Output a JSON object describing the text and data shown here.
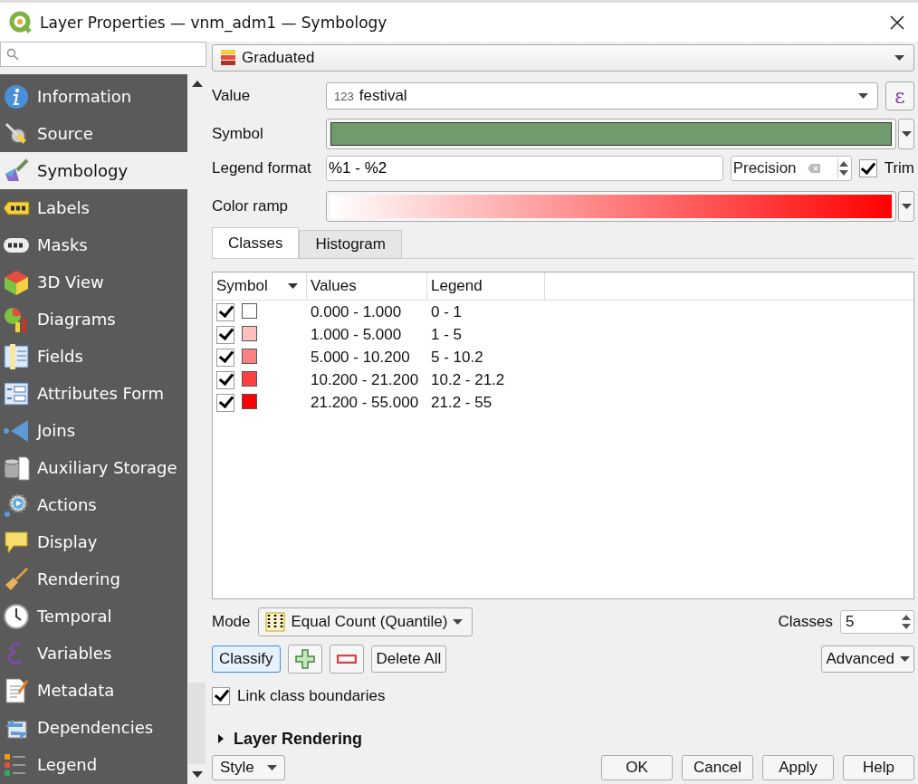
{
  "window": {
    "title": "Layer Properties — vnm_adm1 — Symbology"
  },
  "sidebar": {
    "items": [
      {
        "label": "Information",
        "selected": false
      },
      {
        "label": "Source",
        "selected": false
      },
      {
        "label": "Symbology",
        "selected": true
      },
      {
        "label": "Labels",
        "selected": false
      },
      {
        "label": "Masks",
        "selected": false
      },
      {
        "label": "3D View",
        "selected": false
      },
      {
        "label": "Diagrams",
        "selected": false
      },
      {
        "label": "Fields",
        "selected": false
      },
      {
        "label": "Attributes Form",
        "selected": false
      },
      {
        "label": "Joins",
        "selected": false
      },
      {
        "label": "Auxiliary Storage",
        "selected": false
      },
      {
        "label": "Actions",
        "selected": false
      },
      {
        "label": "Display",
        "selected": false
      },
      {
        "label": "Rendering",
        "selected": false
      },
      {
        "label": "Temporal",
        "selected": false
      },
      {
        "label": "Variables",
        "selected": false
      },
      {
        "label": "Metadata",
        "selected": false
      },
      {
        "label": "Dependencies",
        "selected": false
      },
      {
        "label": "Legend",
        "selected": false
      }
    ]
  },
  "renderer": "Graduated",
  "value": {
    "label": "Value",
    "type_badge": "123",
    "field": "festival",
    "expression_glyph": "ε"
  },
  "symbol": {
    "label": "Symbol"
  },
  "legend_format": {
    "label": "Legend format",
    "value": "%1 - %2",
    "precision_placeholder": "Precision",
    "trim": {
      "label": "Trim",
      "checked": true
    }
  },
  "color_ramp": {
    "label": "Color ramp"
  },
  "tabs": [
    {
      "label": "Classes",
      "selected": true
    },
    {
      "label": "Histogram",
      "selected": false
    }
  ],
  "table": {
    "columns": [
      "Symbol",
      "Values",
      "Legend"
    ],
    "rows": [
      {
        "checked": true,
        "color": "#ffffff",
        "values": "0.000 - 1.000",
        "legend": "0 - 1"
      },
      {
        "checked": true,
        "color": "#ffbfbf",
        "values": "1.000 - 5.000",
        "legend": "1 - 5"
      },
      {
        "checked": true,
        "color": "#ff8080",
        "values": "5.000 - 10.200",
        "legend": "5 - 10.2"
      },
      {
        "checked": true,
        "color": "#ff4040",
        "values": "10.200 - 21.200",
        "legend": "10.2 - 21.2"
      },
      {
        "checked": true,
        "color": "#ff0000",
        "values": "21.200 - 55.000",
        "legend": "21.2 - 55"
      }
    ]
  },
  "mode": {
    "label": "Mode",
    "value": "Equal Count (Quantile)"
  },
  "classes": {
    "label": "Classes",
    "value": "5"
  },
  "buttons": {
    "classify": "Classify",
    "delete_all": "Delete All",
    "advanced": "Advanced"
  },
  "link_class_boundaries": {
    "label": "Link class boundaries",
    "checked": true
  },
  "layer_rendering": {
    "label": "Layer Rendering",
    "expanded": false
  },
  "footer": {
    "style": "Style",
    "actions": [
      "OK",
      "Cancel",
      "Apply",
      "Help"
    ]
  }
}
